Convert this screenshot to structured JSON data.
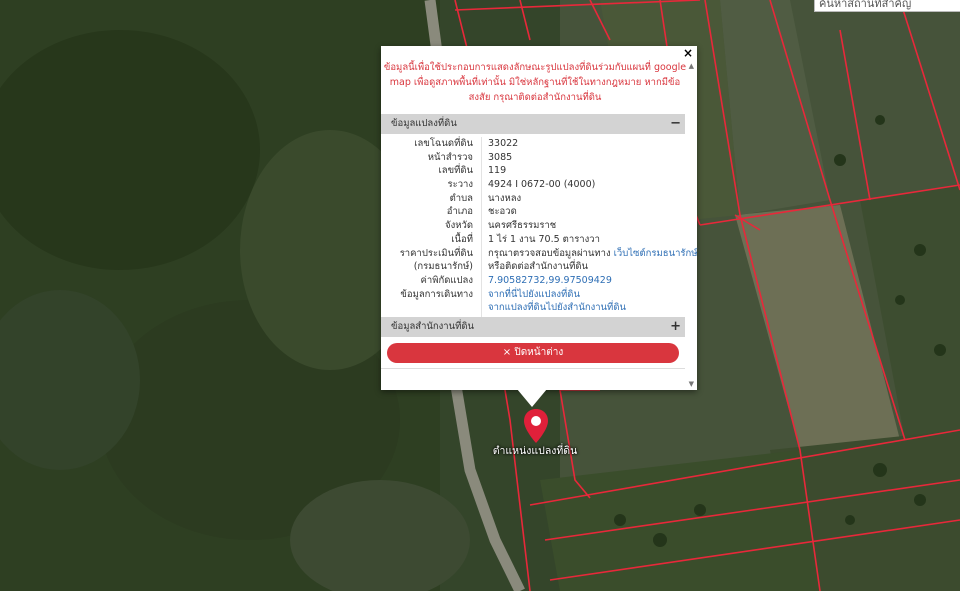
{
  "search": {
    "placeholder": "ค้นหาสถานที่สำคัญ"
  },
  "popup": {
    "close_glyph": "×",
    "notice": "ข้อมูลนี้เพื่อใช้ประกอบการแสดงลักษณะรูปแปลงที่ดินร่วมกับแผนที่ google map เพื่อดูสภาพพื้นที่เท่านั้น มิใช่หลักฐานที่ใช้ในทางกฎหมาย หากมีข้อสงสัย กรุณาติดต่อสำนักงานที่ดิน",
    "parcel_section": {
      "title": "ข้อมูลแปลงที่ดิน",
      "toggle": "−"
    },
    "rows": [
      {
        "label": "เลขโฉนดที่ดิน",
        "value": "33022"
      },
      {
        "label": "หน้าสำรวจ",
        "value": "3085"
      },
      {
        "label": "เลขที่ดิน",
        "value": "119"
      },
      {
        "label": "ระวาง",
        "value": "4924 I 0672-00 (4000)"
      },
      {
        "label": "ตำบล",
        "value": "นางหลง"
      },
      {
        "label": "อำเภอ",
        "value": "ชะอวด"
      },
      {
        "label": "จังหวัด",
        "value": "นครศรีธรรมราช"
      },
      {
        "label": "เนื้อที่",
        "value": "1 ไร่ 1 งาน 70.5 ตารางวา"
      },
      {
        "label": "ราคาประเมินที่ดิน",
        "value": "กรุณาตรวจสอบข้อมูลผ่านทาง",
        "link": "เว็บไซต์กรมธนารักษ์"
      },
      {
        "label": "(กรมธนารักษ์)",
        "value": "หรือติดต่อสำนักงานที่ดิน"
      },
      {
        "label": "ค่าพิกัดแปลง",
        "value": "",
        "link": "7.90582732,99.97509429"
      },
      {
        "label": "ข้อมูลการเดินทาง",
        "value": "",
        "link": "จากที่นี่ไปยังแปลงที่ดิน"
      },
      {
        "label": "",
        "value": "",
        "link": "จากแปลงที่ดินไปยังสำนักงานที่ดิน"
      }
    ],
    "office_section": {
      "title": "ข้อมูลสำนักงานที่ดิน",
      "toggle": "+"
    },
    "close_button": {
      "icon": "×",
      "label": "ปิดหน้าต่าง"
    }
  },
  "marker": {
    "label": "ตำแหน่งแปลงที่ดิน",
    "color": "#e0203a"
  },
  "colors": {
    "accent": "#d9363e",
    "boundary": "#e8283a",
    "link": "#2f6fb5"
  }
}
